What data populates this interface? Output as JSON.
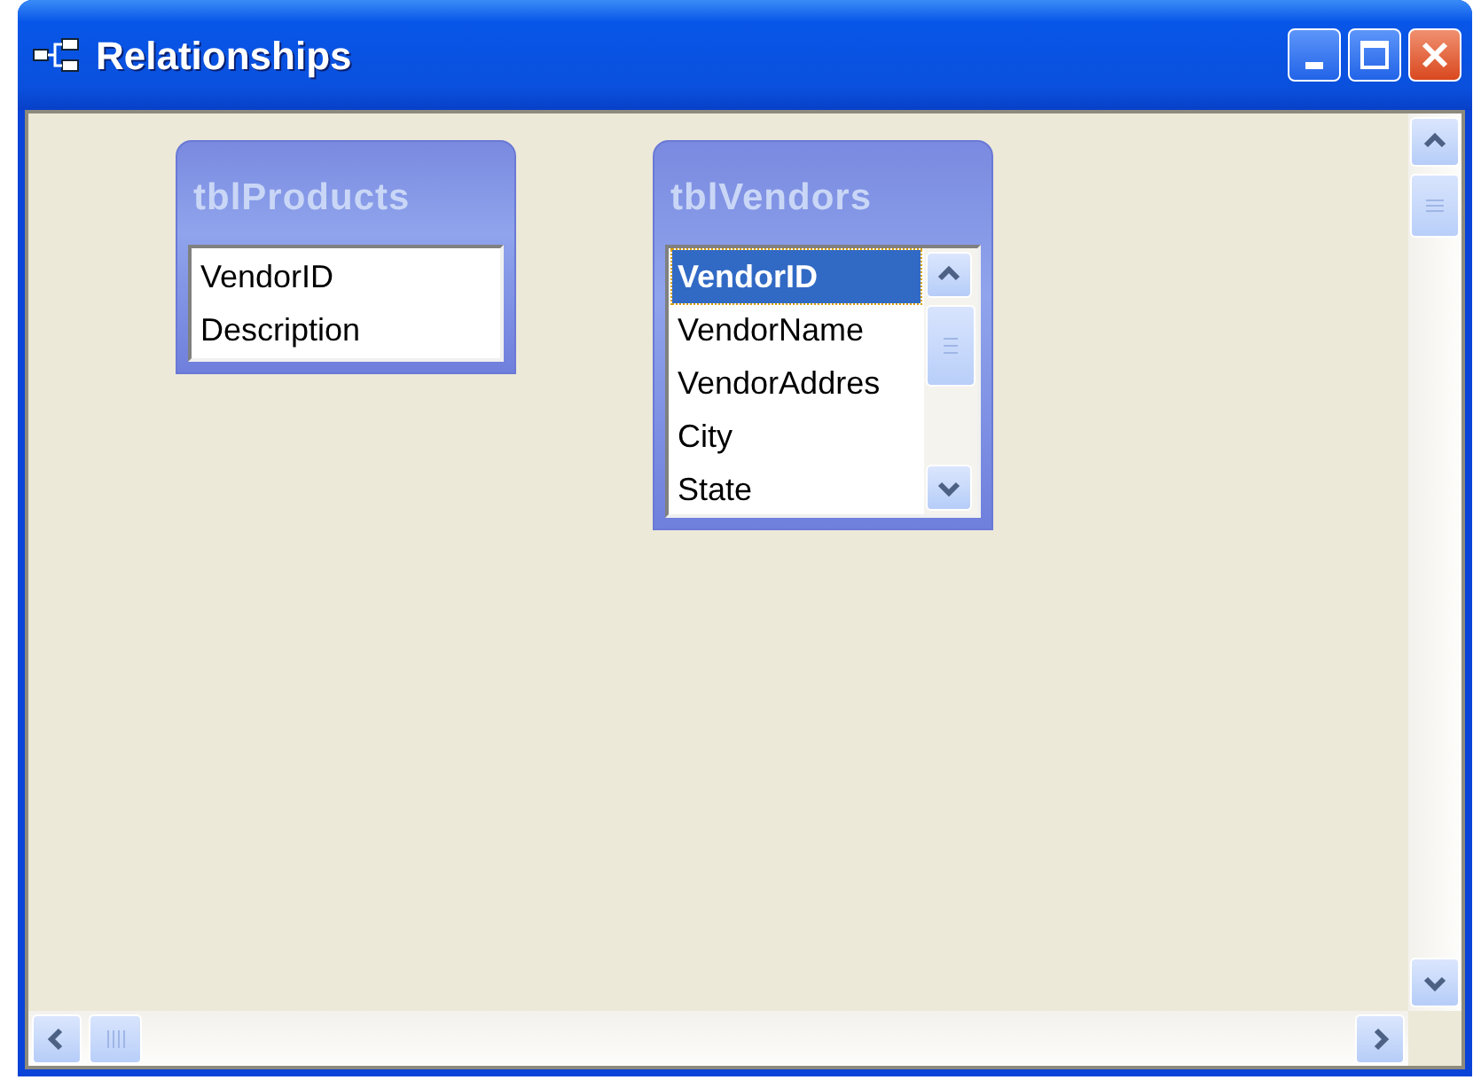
{
  "window": {
    "title": "Relationships"
  },
  "tables": [
    {
      "title": "tblProducts",
      "scrollable": false,
      "fields": [
        {
          "name": "VendorID",
          "selected": false
        },
        {
          "name": "Description",
          "selected": false
        }
      ]
    },
    {
      "title": "tblVendors",
      "scrollable": true,
      "fields": [
        {
          "name": "VendorID",
          "selected": true
        },
        {
          "name": "VendorName",
          "selected": false
        },
        {
          "name": "VendorAddres",
          "selected": false
        },
        {
          "name": "City",
          "selected": false
        },
        {
          "name": "State",
          "selected": false
        }
      ]
    }
  ]
}
